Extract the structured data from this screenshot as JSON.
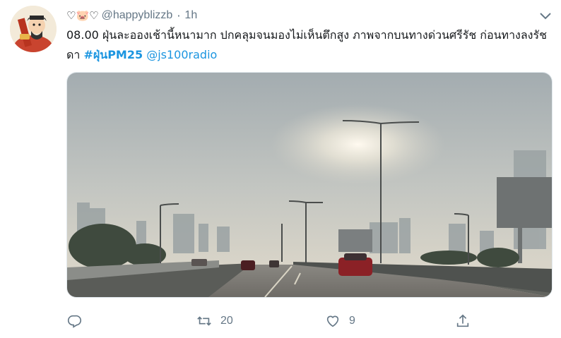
{
  "tweet": {
    "display_name": "♡🐷♡",
    "handle": "@happyblizzb",
    "separator": "·",
    "time": "1h",
    "text_plain": "08.00 ฝุ่นละอองเช้านี้หนามาก ปกคลุมจนมองไม่เห็นตึกสูง ภาพจากบนทางด่วนศรีรัช ก่อนทางลงรัชดา ",
    "hashtag": "#ฝุ่นPM25",
    "mention": "@js100radio"
  },
  "actions": {
    "reply_count": "",
    "retweet_count": "20",
    "like_count": "9"
  },
  "icons": [
    "avatar-illustration",
    "chevron-down-icon",
    "reply-icon",
    "retweet-icon",
    "like-icon",
    "share-icon"
  ],
  "colors": {
    "link": "#1b95e0",
    "muted": "#657786",
    "text": "#14171a"
  }
}
